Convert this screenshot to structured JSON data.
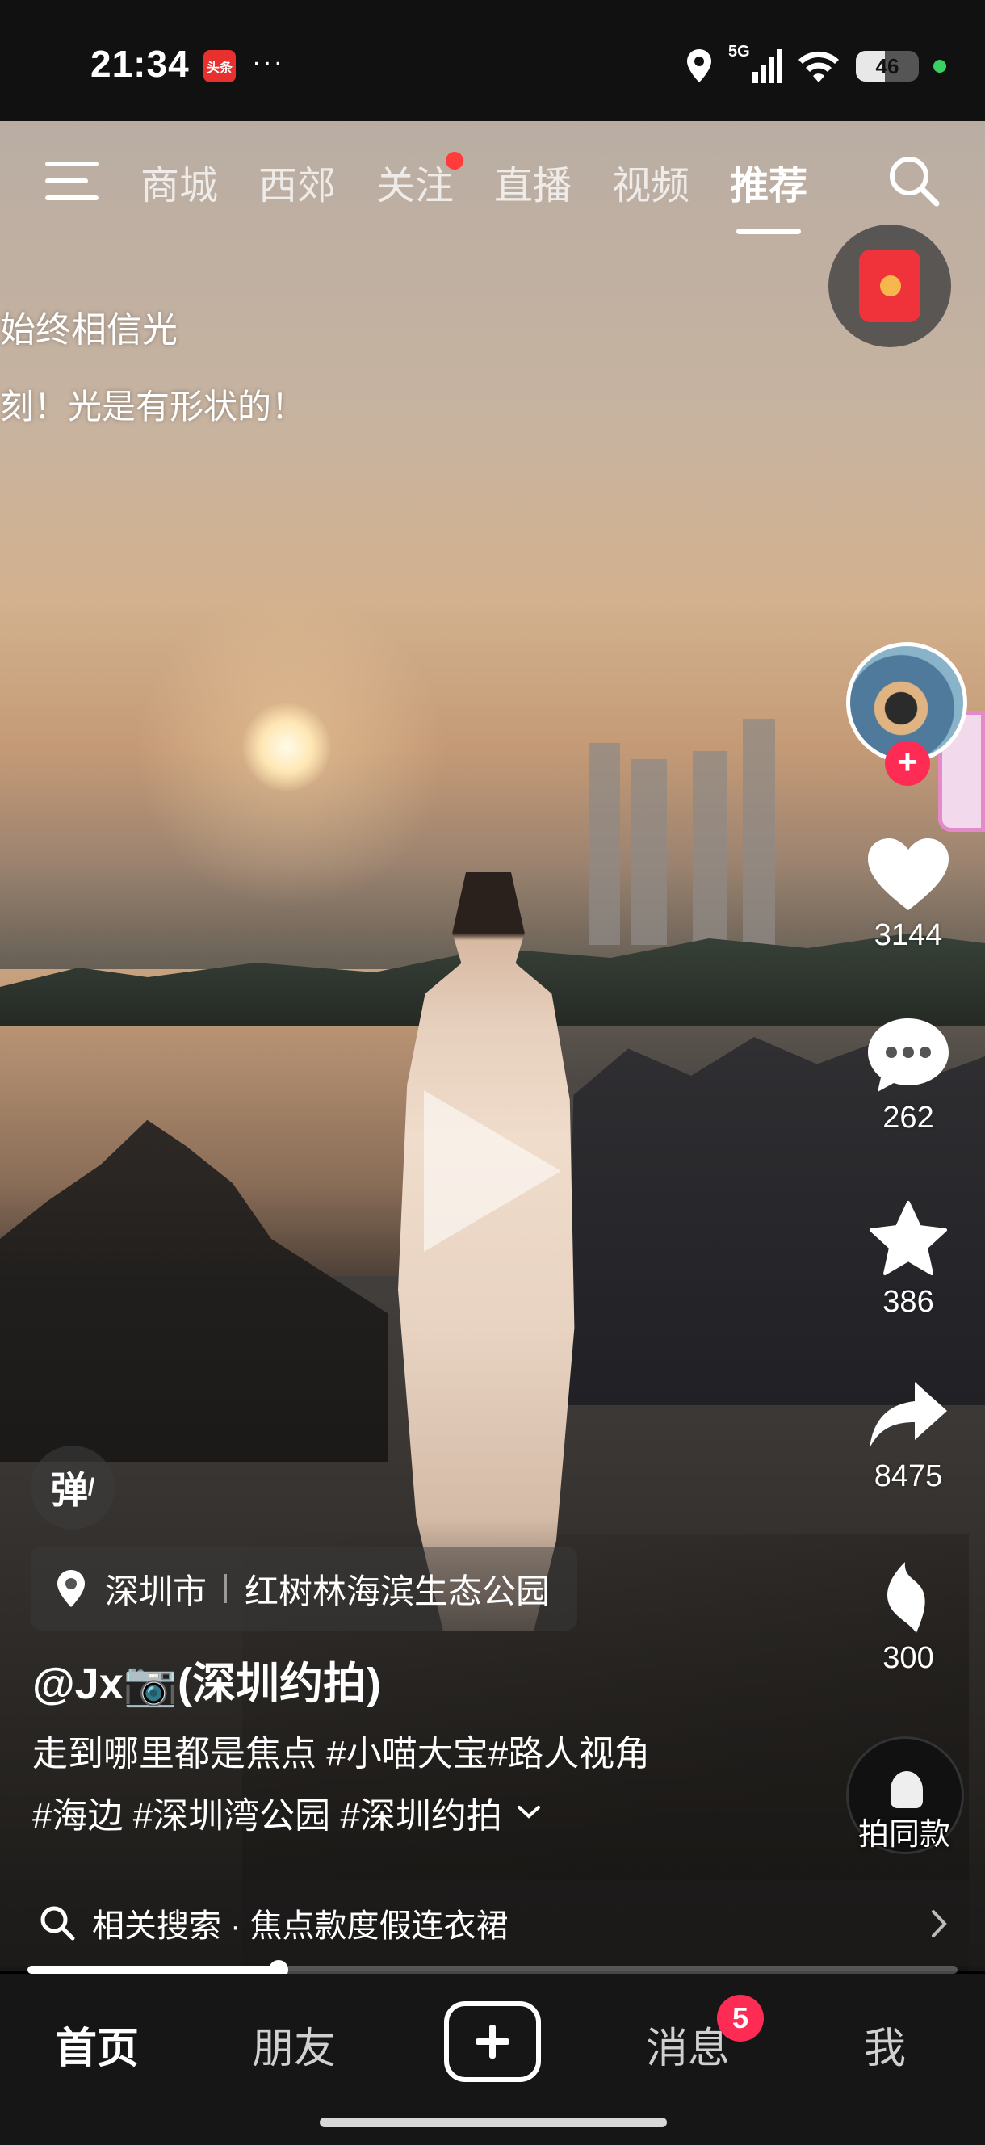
{
  "status_bar": {
    "time": "21:34",
    "app_badge": "头条",
    "more": "···",
    "network": "5G",
    "battery": "46",
    "battery_level_percent": 46
  },
  "top_nav": {
    "tabs": [
      {
        "label": "商城",
        "active": false,
        "dot": false
      },
      {
        "label": "西郊",
        "active": false,
        "dot": false
      },
      {
        "label": "关注",
        "active": false,
        "dot": true
      },
      {
        "label": "直播",
        "active": false,
        "dot": false
      },
      {
        "label": "视频",
        "active": false,
        "dot": false
      },
      {
        "label": "推荐",
        "active": true,
        "dot": false
      }
    ]
  },
  "overlay_captions": {
    "line1": "始终相信光",
    "line2": "刻！光是有形状的！"
  },
  "sidebar": {
    "likes": "3144",
    "comments": "262",
    "favorites": "386",
    "shares": "8475",
    "misc": "300",
    "remix_label": "拍同款"
  },
  "danmu_label": "弹",
  "location": {
    "city": "深圳市",
    "place": "红树林海滨生态公园"
  },
  "author": {
    "username": "@Jx📷(深圳约拍)"
  },
  "description": {
    "line1": "走到哪里都是焦点 #小喵大宝#路人视角",
    "line2": "#海边 #深圳湾公园 #深圳约拍"
  },
  "related_search": {
    "text": "相关搜索 · 焦点款度假连衣裙"
  },
  "playback_progress": 0.27,
  "bottom_nav": {
    "home": "首页",
    "friends": "朋友",
    "messages": "消息",
    "messages_badge": "5",
    "me": "我"
  },
  "colors": {
    "accent_red": "#fe2c55",
    "nav_bg": "#161616",
    "status_green": "#3ad162"
  }
}
